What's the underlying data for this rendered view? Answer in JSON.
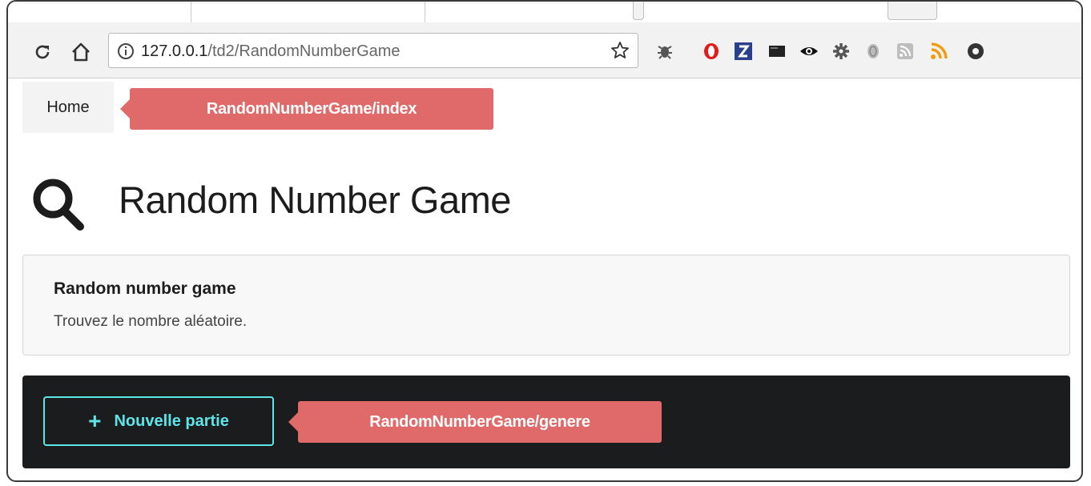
{
  "browser": {
    "url_host": "127.0.0.1",
    "url_path": "/td2/RandomNumberGame",
    "extensions": [
      "bug-icon",
      "opera-icon",
      "zotero-icon",
      "terminal-icon",
      "eye-icon",
      "gear-extension-icon",
      "fingerprint-icon",
      "rss-gray-icon",
      "rss-orange-icon",
      "chrome-icon"
    ]
  },
  "nav": {
    "home_label": "Home",
    "route_annotation": "RandomNumberGame/index"
  },
  "page": {
    "title": "Random Number Game",
    "title_icon": "search-icon"
  },
  "segment": {
    "header": "Random number game",
    "description": "Trouvez le nombre aléatoire."
  },
  "actions": {
    "new_game_label": "Nouvelle partie",
    "new_game_icon": "plus-icon",
    "route_annotation": "RandomNumberGame/genere"
  },
  "colors": {
    "annotation": "#e06a69",
    "button_accent": "#5ee5e8",
    "dark_bar": "#1b1c1d"
  }
}
